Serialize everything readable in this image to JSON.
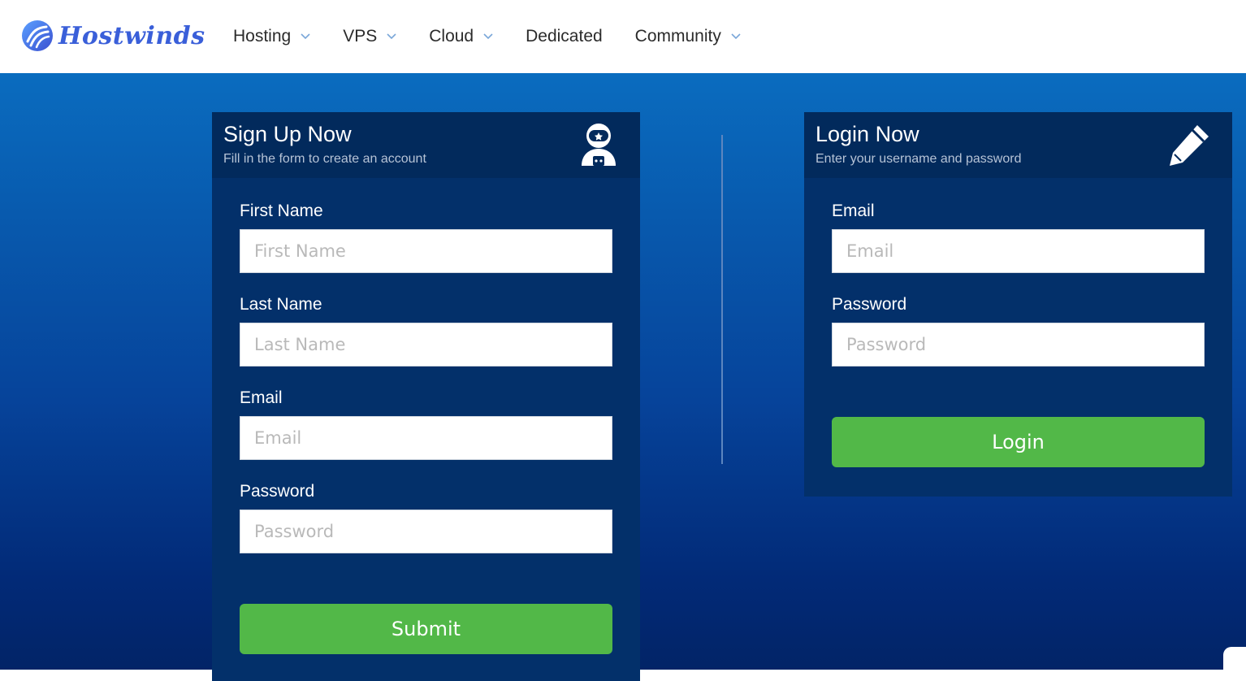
{
  "brand": {
    "name": "Hostwinds"
  },
  "nav": {
    "items": [
      {
        "label": "Hosting",
        "has_dropdown": true
      },
      {
        "label": "VPS",
        "has_dropdown": true
      },
      {
        "label": "Cloud",
        "has_dropdown": true
      },
      {
        "label": "Dedicated",
        "has_dropdown": false
      },
      {
        "label": "Community",
        "has_dropdown": true
      }
    ]
  },
  "signup": {
    "title": "Sign Up Now",
    "subtitle": "Fill in the form to create an account",
    "icon": "astronaut-icon",
    "fields": {
      "first_name": {
        "label": "First Name",
        "placeholder": "First Name",
        "value": ""
      },
      "last_name": {
        "label": "Last Name",
        "placeholder": "Last Name",
        "value": ""
      },
      "email": {
        "label": "Email",
        "placeholder": "Email",
        "value": ""
      },
      "password": {
        "label": "Password",
        "placeholder": "Password",
        "value": ""
      }
    },
    "submit_label": "Submit"
  },
  "login": {
    "title": "Login Now",
    "subtitle": "Enter your username and password",
    "icon": "pencil-icon",
    "fields": {
      "email": {
        "label": "Email",
        "placeholder": "Email",
        "value": ""
      },
      "password": {
        "label": "Password",
        "placeholder": "Password",
        "value": ""
      }
    },
    "login_label": "Login"
  },
  "colors": {
    "brand_blue": "#3a5fd9",
    "panel_bg": "#03306a",
    "panel_header": "#022a5c",
    "button_green": "#52b848",
    "hero_top": "#0a6cbf",
    "hero_bottom": "#022467"
  }
}
